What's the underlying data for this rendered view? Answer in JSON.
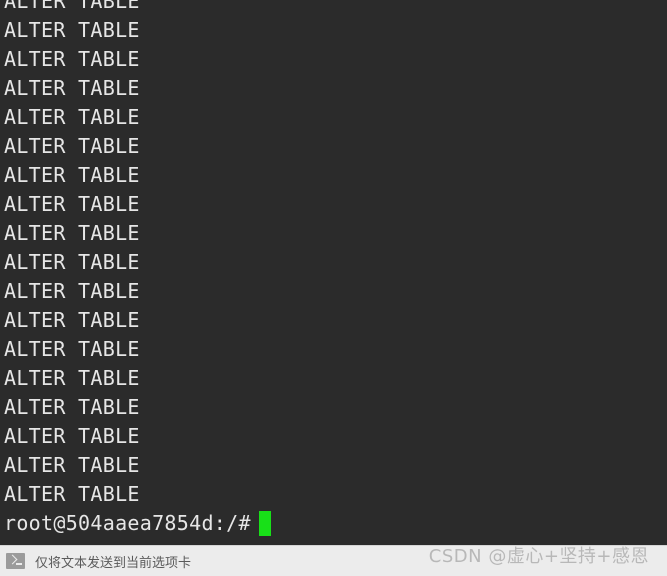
{
  "colors": {
    "terminal_background": "#2b2b2b",
    "terminal_foreground": "#e6e6e6",
    "cursor": "#18e018",
    "statusbar_background": "#ececec",
    "statusbar_foreground": "#5a5a5a",
    "watermark": "#b6b6b6"
  },
  "terminal": {
    "output_lines": [
      "ALTER TABLE",
      "ALTER TABLE",
      "ALTER TABLE",
      "ALTER TABLE",
      "ALTER TABLE",
      "ALTER TABLE",
      "ALTER TABLE",
      "ALTER TABLE",
      "ALTER TABLE",
      "ALTER TABLE",
      "ALTER TABLE",
      "ALTER TABLE",
      "ALTER TABLE",
      "ALTER TABLE",
      "ALTER TABLE",
      "ALTER TABLE",
      "ALTER TABLE",
      "ALTER TABLE"
    ],
    "prompt": "root@504aaea7854d:/#",
    "command_input": "",
    "cursor_glyph": "block-cursor"
  },
  "statusbar": {
    "icon": "terminal-prompt-icon",
    "message": "仅将文本发送到当前选项卡"
  },
  "watermark": {
    "text": "CSDN @虚心+坚持+感恩"
  }
}
